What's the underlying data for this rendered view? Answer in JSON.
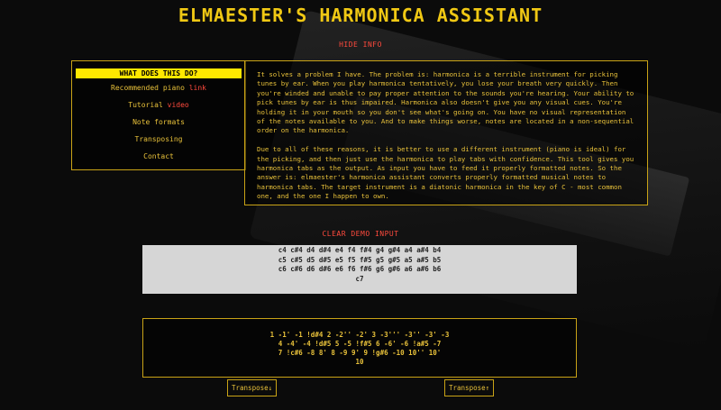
{
  "header": {
    "title": "ELMAESTER'S HARMONICA ASSISTANT"
  },
  "info_toggle": {
    "label": "HIDE INFO"
  },
  "menu": {
    "items": [
      {
        "label": "WHAT DOES THIS DO?"
      },
      {
        "label": "Recommended piano ",
        "link": "link"
      },
      {
        "label": "Tutorial ",
        "link": "video"
      },
      {
        "label": "Note formats"
      },
      {
        "label": "Transposing"
      },
      {
        "label": "Contact"
      }
    ]
  },
  "info": {
    "paragraphs": [
      "It solves a problem I have. The problem is: harmonica is a terrible instrument for picking tunes by ear. When you play harmonica tentatively, you lose your breath very quickly. Then you're winded and unable to pay proper attention to the sounds you're hearing. Your ability to pick tunes by ear is thus impaired. Harmonica also doesn't give you any visual cues. You're holding it in your mouth so you don't see what's going on. You have no visual representation of the notes available to you. And to make things worse, notes are located in a non-sequential order on the harmonica.",
      "Due to all of these reasons, it is better to use a different instrument (piano is ideal) for the picking, and then just use the harmonica to play tabs with confidence. This tool gives you harmonica tabs as the output. As input you have to feed it properly formatted notes. So the answer is: elmaester's harmonica assistant converts properly formatted musical notes to harmonica tabs. The target instrument is a diatonic harmonica in the key of C - most common one, and the one I happen to own."
    ]
  },
  "demo_toggle": {
    "label": "CLEAR DEMO INPUT"
  },
  "input": {
    "lines": [
      "c4 c#4 d4 d#4 e4 f4 f#4 g4 g#4 a4 a#4 b4",
      "c5 c#5 d5 d#5 e5 f5 f#5 g5 g#5 a5 a#5 b5",
      "c6 c#6 d6 d#6 e6 f6 f#6 g6 g#6 a6 a#6 b6",
      "c7"
    ]
  },
  "output": {
    "lines": [
      "1 -1' -1 !d#4 2 -2'' -2' 3 -3''' -3'' -3' -3",
      "4 -4' -4 !d#5 5 -5 !f#5 6 -6' -6 !a#5 -7",
      "7 !c#6 -8 8' 8 -9 9' 9 !g#6 -10 10'' 10'",
      "10"
    ]
  },
  "buttons": {
    "transpose_down": "Transpose↓",
    "transpose_up": "Transpose↑"
  },
  "colors": {
    "accent": "#e8c13a",
    "title": "#f0c814",
    "link": "#ff4a3d",
    "highlight": "#ffe800",
    "background": "#0b0b0b"
  }
}
